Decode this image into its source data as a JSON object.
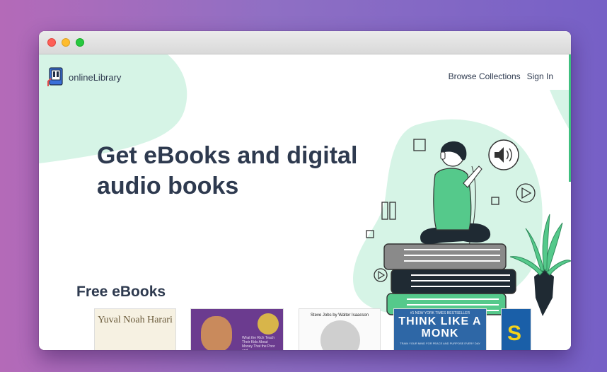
{
  "app": {
    "logo_text": "onlineLibrary"
  },
  "nav": {
    "browse": "Browse Collections",
    "signin": "Sign In"
  },
  "hero": {
    "title": "Get eBooks and digital audio books"
  },
  "section": {
    "title": "Free eBooks"
  },
  "books": [
    {
      "title": "Yuval Noah Harari"
    },
    {
      "blurb": "What the Rich Teach Their Kids About Money That the Poor and"
    },
    {
      "author_line": "Steve Jobs by Walter Isaacson"
    },
    {
      "kicker": "#1 NEW YORK TIMES BESTSELLER",
      "title": "THINK LIKE A MONK",
      "subtitle": "TRAIN YOUR MIND FOR PEACE AND PURPOSE EVERY DAY"
    },
    {
      "title": "S"
    }
  ],
  "colors": {
    "accent_mint": "#d6f4e6",
    "accent_green": "#3fbf7f",
    "text": "#2e3a4f"
  }
}
